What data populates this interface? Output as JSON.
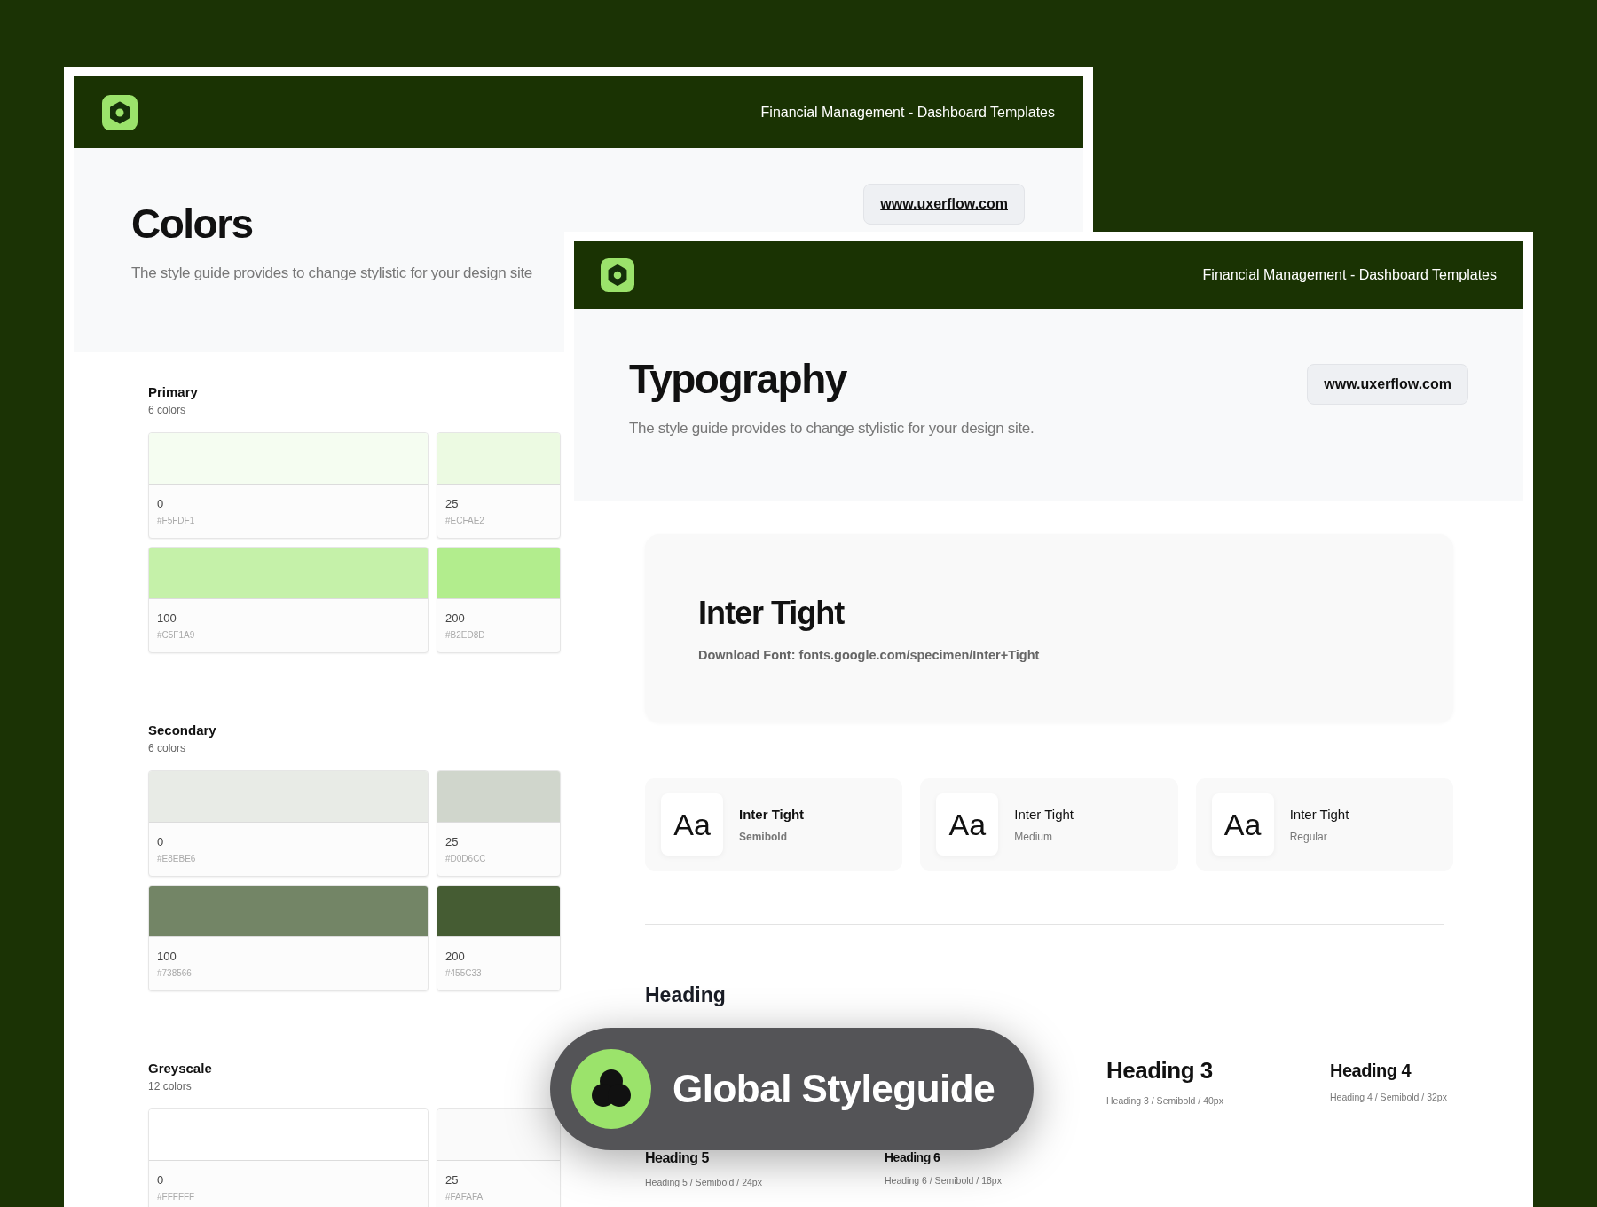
{
  "back_window": {
    "header_title": "Financial Management - Dashboard Templates",
    "title": "Colors",
    "description": "The style guide provides to change stylistic for your design site",
    "link": "www.uxerflow.com",
    "palettes": [
      {
        "name": "Primary",
        "count": "6 colors",
        "swatches": [
          {
            "label": "0",
            "hex": "#F5FDF1",
            "color": "#f5fdf1"
          },
          {
            "label": "25",
            "hex": "#ECFAE2",
            "color": "#ecfae2"
          },
          {
            "label": "100",
            "hex": "#C5F1A9",
            "color": "#c5f1a9"
          },
          {
            "label": "200",
            "hex": "#B2ED8D",
            "color": "#b2ed8d"
          }
        ]
      },
      {
        "name": "Secondary",
        "count": "6 colors",
        "swatches": [
          {
            "label": "0",
            "hex": "#E8EBE6",
            "color": "#e8ebe6"
          },
          {
            "label": "25",
            "hex": "#D0D6CC",
            "color": "#d0d6cc"
          },
          {
            "label": "100",
            "hex": "#738566",
            "color": "#738566"
          },
          {
            "label": "200",
            "hex": "#455C33",
            "color": "#455c33"
          }
        ]
      },
      {
        "name": "Greyscale",
        "count": "12 colors",
        "swatches": [
          {
            "label": "0",
            "hex": "#FFFFFF",
            "color": "#ffffff"
          },
          {
            "label": "25",
            "hex": "#FAFAFA",
            "color": "#fafafa"
          }
        ]
      }
    ]
  },
  "front_window": {
    "header_title": "Financial Management - Dashboard Templates",
    "title": "Typography",
    "description": "The style guide provides to change stylistic for your design site.",
    "link": "www.uxerflow.com",
    "font": {
      "name": "Inter Tight",
      "download": "Download Font: fonts.google.com/specimen/Inter+Tight"
    },
    "weights": [
      {
        "sample": "Aa",
        "name": "Inter Tight",
        "weight": "Semibold",
        "kind": "semibold"
      },
      {
        "sample": "Aa",
        "name": "Inter Tight",
        "weight": "Medium",
        "kind": "medium"
      },
      {
        "sample": "Aa",
        "name": "Inter Tight",
        "weight": "Regular",
        "kind": "regular"
      }
    ],
    "section_title": "Heading",
    "headings": [
      {
        "label": "Heading 3",
        "spec": "Heading 3 / Semibold / 40px",
        "kind": "h3"
      },
      {
        "label": "Heading 4",
        "spec": "Heading 4 / Semibold / 32px",
        "kind": "h4"
      },
      {
        "label": "Heading 5",
        "spec": "Heading 5 / Semibold / 24px",
        "kind": "h5"
      },
      {
        "label": "Heading 6",
        "spec": "Heading 6 / Semibold / 18px",
        "kind": "h6"
      }
    ]
  },
  "badge": {
    "label": "Global Styleguide"
  }
}
